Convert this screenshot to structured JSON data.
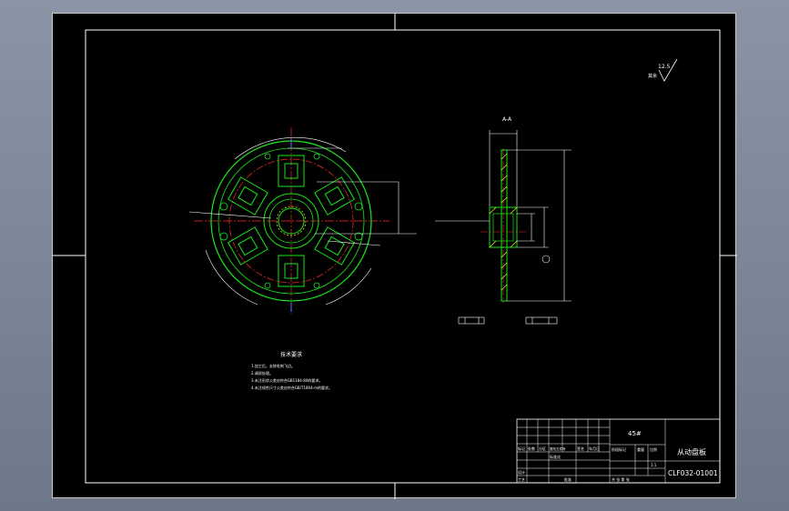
{
  "drawing": {
    "material": "45#",
    "part_name": "从动盘板",
    "drawing_number": "CLF032-01001",
    "section_label": "A-A",
    "roughness_note": "12.5",
    "technical_requirements": {
      "title": "技术要求",
      "items": [
        "1.加工后，去除毛刺飞边。",
        "2.调质处理。",
        "3.未注形状公差应符合GB1184-80的要求。",
        "4.未注线性尺寸公差应符合GB/T1804-m的要求。"
      ]
    },
    "title_block": {
      "row_labels": [
        "标记",
        "处数",
        "分区",
        "更改文件号",
        "签名",
        "年月日"
      ],
      "design_label": "设计",
      "process_label": "工艺",
      "standard_label": "标准化",
      "approve_label": "批准",
      "stage_label": "阶段标记",
      "weight_label": "重量",
      "scale_label": "比例",
      "scale_value": "1:1",
      "sheet_label": "共 张 第 张"
    }
  }
}
